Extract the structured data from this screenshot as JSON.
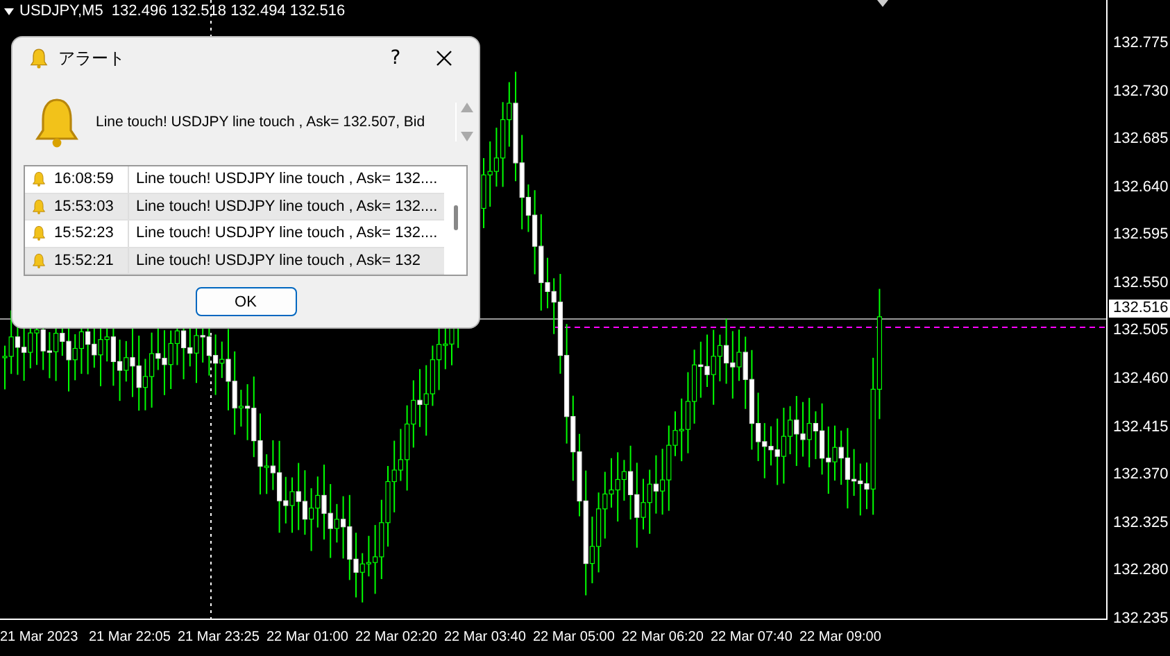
{
  "chart": {
    "header": "USDJPY,M5  132.496 132.518 132.494 132.516",
    "price_ticks": [
      "132.775",
      "132.730",
      "132.685",
      "132.640",
      "132.595",
      "132.550",
      "132.505",
      "132.460",
      "132.415",
      "132.370",
      "132.325",
      "132.280",
      "132.235"
    ],
    "current_price": "132.516",
    "time_labels": [
      "21 Mar 2023",
      "21 Mar 22:05",
      "21 Mar 23:25",
      "22 Mar 01:00",
      "22 Mar 02:20",
      "22 Mar 03:40",
      "22 Mar 05:00",
      "22 Mar 06:20",
      "22 Mar 07:40",
      "22 Mar 09:00"
    ]
  },
  "alert_dialog": {
    "title": "アラート",
    "help": "?",
    "message": "Line touch! USDJPY line touch , Ask= 132.507, Bid",
    "log": [
      {
        "time": "16:08:59",
        "text": "Line touch! USDJPY line touch , Ask= 132...."
      },
      {
        "time": "15:53:03",
        "text": "Line touch! USDJPY line touch , Ask= 132...."
      },
      {
        "time": "15:52:23",
        "text": "Line touch! USDJPY line touch , Ask= 132...."
      },
      {
        "time": "15:52:21",
        "text": "Line touch! USDJPY line touch , Ask= 132"
      }
    ],
    "ok_button": "OK"
  }
}
